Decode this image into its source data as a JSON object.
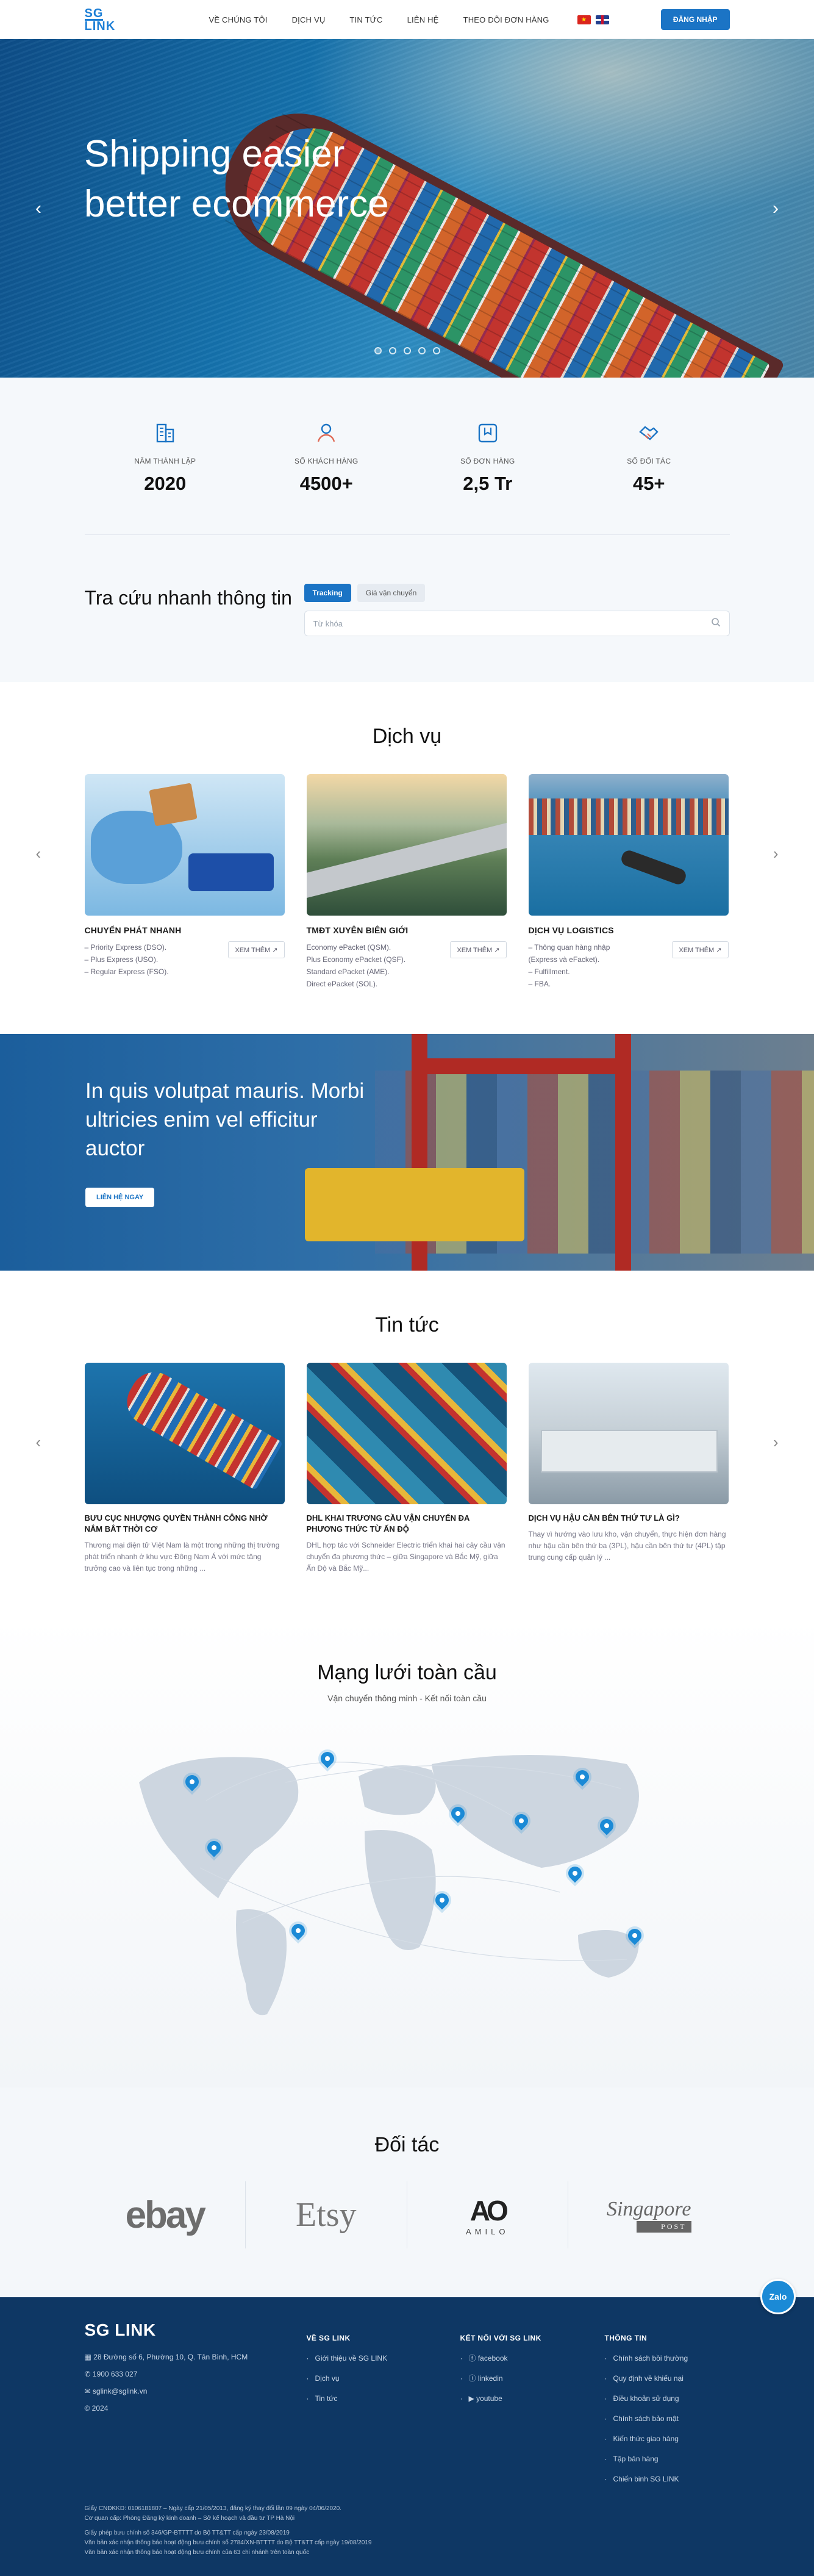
{
  "header": {
    "logo_line1": "SG",
    "logo_line2": "LINK",
    "nav": [
      "VỀ CHÚNG TÔI",
      "DỊCH VỤ",
      "TIN TỨC",
      "LIÊN HỆ",
      "THEO DÕI ĐƠN HÀNG"
    ],
    "login": "ĐĂNG NHẬP"
  },
  "hero": {
    "title": "Shipping easier better ecommerce",
    "prev": "‹",
    "next": "›"
  },
  "stats": [
    {
      "label": "NĂM THÀNH LẬP",
      "value": "2020",
      "icon": "building-icon"
    },
    {
      "label": "SỐ KHÁCH HÀNG",
      "value": "4500+",
      "icon": "user-icon"
    },
    {
      "label": "SỐ ĐƠN HÀNG",
      "value": "2,5 Tr",
      "icon": "bookmark-icon"
    },
    {
      "label": "SỐ ĐỐI TÁC",
      "value": "45+",
      "icon": "handshake-icon"
    }
  ],
  "lookup": {
    "title": "Tra cứu nhanh thông tin",
    "tabs": [
      "Tracking",
      "Giá vận chuyển"
    ],
    "placeholder": "Từ khóa"
  },
  "services": {
    "title": "Dịch vụ",
    "more": "XEM THÊM",
    "items": [
      {
        "title": "CHUYỂN PHÁT NHANH",
        "lines": [
          "– Priority Express (DSO).",
          "– Plus Express (USO).",
          "– Regular Express (FSO)."
        ]
      },
      {
        "title": "TMĐT XUYÊN BIÊN GIỚI",
        "lines": [
          "Economy ePacket (QSM).",
          "Plus Economy ePacket (QSF).",
          "Standard ePacket (AME).",
          "Direct ePacket (SOL)."
        ]
      },
      {
        "title": "DỊCH VỤ LOGISTICS",
        "lines": [
          "– Thông quan hàng nhập",
          "(Express và eFacket).",
          "– Fulfillment.",
          "– FBA."
        ]
      }
    ]
  },
  "banner": {
    "title": "In quis volutpat mauris. Morbi ultricies enim vel efficitur auctor",
    "cta": "LIÊN HỆ NGAY"
  },
  "news": {
    "title": "Tin tức",
    "items": [
      {
        "title": "BƯU CỤC NHƯỢNG QUYỀN THÀNH CÔNG NHỜ NẮM BẮT THỜI CƠ",
        "desc": "Thương mại điện tử Việt Nam là một trong những thị trường phát triển nhanh ở khu vực Đông Nam Á với mức tăng trưởng cao và liên tục trong những ..."
      },
      {
        "title": "DHL KHAI TRƯƠNG CẦU VẬN CHUYỂN ĐA PHƯƠNG THỨC TỪ ẤN ĐỘ",
        "desc": "DHL hợp tác với Schneider Electric triển khai hai cây cầu vận chuyển đa phương thức – giữa Singapore và Bắc Mỹ, giữa Ấn Độ và Bắc Mỹ..."
      },
      {
        "title": "DỊCH VỤ HẬU CẦN BÊN THỨ TƯ LÀ GÌ?",
        "desc": "Thay vì hướng vào lưu kho, vận chuyển, thực hiện đơn hàng như hậu cần bên thứ ba (3PL), hậu cần bên thứ tư (4PL) tập trung cung cấp quản lý ..."
      }
    ]
  },
  "network": {
    "title": "Mạng lưới toàn cầu",
    "subtitle": "Vận chuyển thông minh - Kết nối toàn cầu"
  },
  "partners": {
    "title": "Đối tác",
    "logos": [
      "ebay",
      "Etsy",
      "AO",
      "AMILO",
      "Singapore",
      "POST"
    ]
  },
  "footer": {
    "brand": "SG LINK",
    "address": "28 Đường số 6, Phường 10, Q. Tân Bình, HCM",
    "phone": "1900 633 027",
    "email": "sglink@sglink.vn",
    "copyright": "© 2024",
    "col2_title": "VỀ SG LINK",
    "col2": [
      "Giới thiệu về SG LINK",
      "Dịch vụ",
      "Tin tức"
    ],
    "col3_title": "KẾT NỐI VỚI SG LINK",
    "col3": [
      "facebook",
      "linkedin",
      "youtube"
    ],
    "col4_title": "THÔNG TIN",
    "col4": [
      "Chính sách bồi thường",
      "Quy định về khiếu nại",
      "Điều khoản sử dụng",
      "Chính sách bảo mật",
      "Kiến thức giao hàng",
      "Tập bản hàng",
      "Chiến binh SG LINK"
    ],
    "legal": [
      "Giấy CNĐKKD: 0106181807 – Ngày cấp 21/05/2013, đăng ký thay đổi lần 09 ngày 04/06/2020.",
      "Cơ quan cấp: Phòng Đăng ký kinh doanh – Sở kế hoạch và đầu tư TP Hà Nội",
      "Giấy phép bưu chính số 346/GP-BTTTT do Bộ TT&TT cấp ngày 23/08/2019",
      "Văn bản xác nhận thông báo hoạt động bưu chính số 2784/XN-BTTTT do Bộ TT&TT cấp ngày 19/08/2019",
      "Văn bản xác nhận thông báo hoạt động bưu chính của 63 chi nhánh trên toàn quốc"
    ],
    "zalo": "Zalo"
  }
}
